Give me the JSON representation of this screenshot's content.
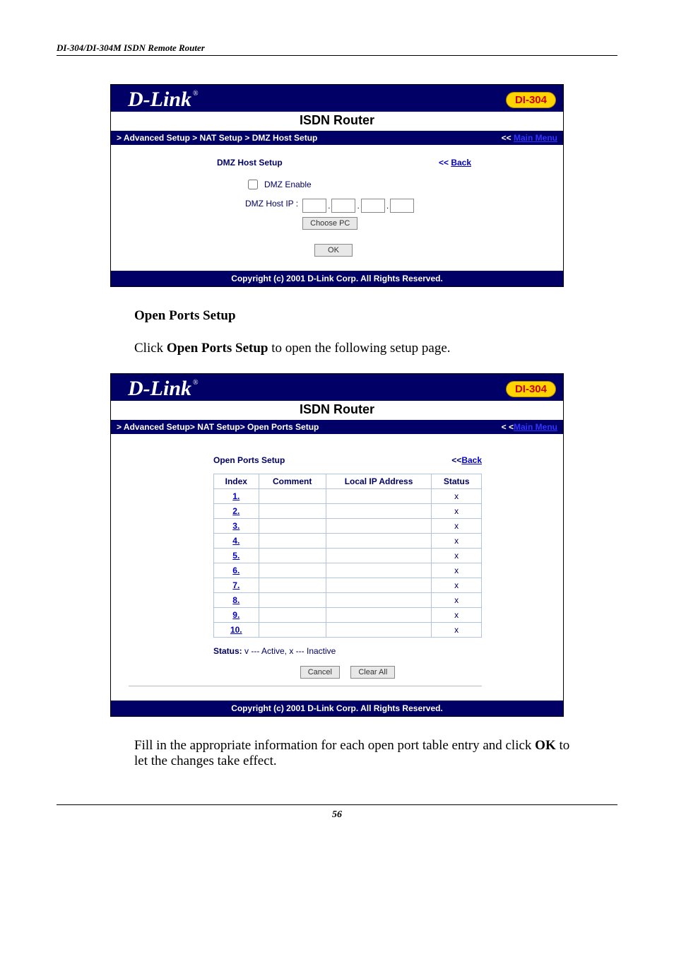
{
  "doc": {
    "header": "DI-304/DI-304M ISDN Remote Router",
    "page_number": "56",
    "section_heading": "Open Ports Setup",
    "intro_prefix": "Click ",
    "intro_bold": "Open Ports Setup",
    "intro_suffix": " to open the following setup page.",
    "outro_prefix": "Fill in the appropriate information for each open port table entry and click ",
    "outro_bold": "OK",
    "outro_suffix": " to let the changes take effect."
  },
  "shot1": {
    "brand": "D-Link",
    "title": "ISDN Router",
    "badge": "DI-304",
    "breadcrumb": "> Advanced Setup > NAT Setup > DMZ Host Setup",
    "main_menu_prefix": "<< ",
    "main_menu_label": "Main Menu",
    "section_title": "DMZ Host Setup",
    "back_prefix": "<< ",
    "back_label": "Back",
    "dmz_enable_label": "DMZ Enable",
    "dmz_host_ip_label": "DMZ Host IP :",
    "choose_pc_label": "Choose PC",
    "ok_label": "OK",
    "copyright": "Copyright (c) 2001 D-Link Corp. All Rights Reserved."
  },
  "shot2": {
    "brand": "D-Link",
    "title": "ISDN Router",
    "badge": "DI-304",
    "breadcrumb": "> Advanced Setup> NAT Setup> Open Ports Setup",
    "main_menu_prefix": "< <",
    "main_menu_label": "Main Menu",
    "section_title": "Open Ports Setup",
    "back_prefix": "<<",
    "back_label": "Back",
    "columns": {
      "index": "Index",
      "comment": "Comment",
      "local_ip": "Local IP Address",
      "status": "Status"
    },
    "rows": [
      {
        "index": "1.",
        "comment": "",
        "local_ip": "",
        "status": "x"
      },
      {
        "index": "2.",
        "comment": "",
        "local_ip": "",
        "status": "x"
      },
      {
        "index": "3.",
        "comment": "",
        "local_ip": "",
        "status": "x"
      },
      {
        "index": "4.",
        "comment": "",
        "local_ip": "",
        "status": "x"
      },
      {
        "index": "5.",
        "comment": "",
        "local_ip": "",
        "status": "x"
      },
      {
        "index": "6.",
        "comment": "",
        "local_ip": "",
        "status": "x"
      },
      {
        "index": "7.",
        "comment": "",
        "local_ip": "",
        "status": "x"
      },
      {
        "index": "8.",
        "comment": "",
        "local_ip": "",
        "status": "x"
      },
      {
        "index": "9.",
        "comment": "",
        "local_ip": "",
        "status": "x"
      },
      {
        "index": "10.",
        "comment": "",
        "local_ip": "",
        "status": "x"
      }
    ],
    "status_legend_label": "Status:",
    "status_legend_text": " v --- Active, x --- Inactive",
    "cancel_label": "Cancel",
    "clear_all_label": "Clear All",
    "copyright": "Copyright (c) 2001 D-Link Corp. All Rights Reserved."
  }
}
